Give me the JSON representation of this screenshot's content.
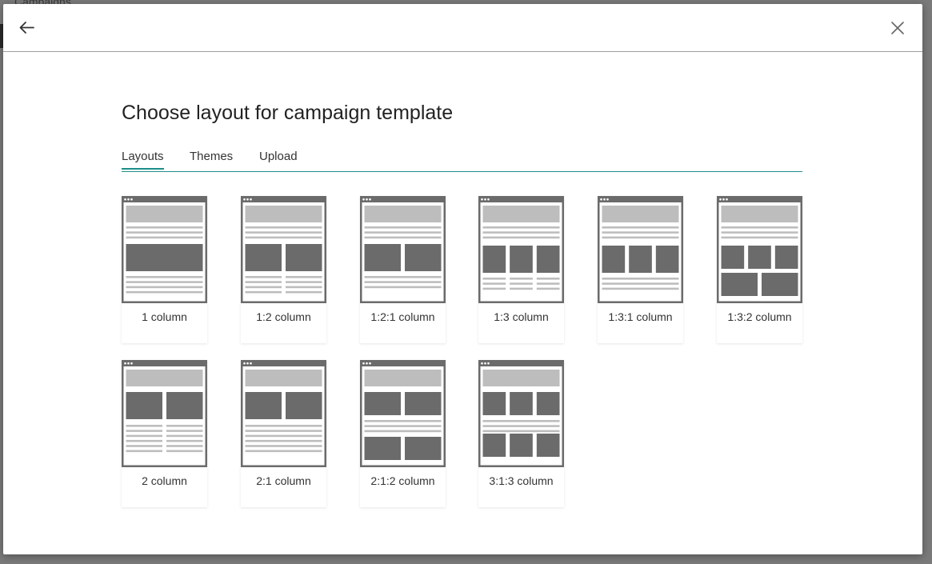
{
  "background": {
    "breadcrumb_text": "Campaigns"
  },
  "header": {
    "back_icon": "arrow-left-icon",
    "close_icon": "close-icon"
  },
  "title": "Choose layout for campaign template",
  "tabs": [
    {
      "label": "Layouts",
      "active": true
    },
    {
      "label": "Themes",
      "active": false
    },
    {
      "label": "Upload",
      "active": false
    }
  ],
  "layouts": [
    {
      "label": "1 column",
      "kind": "one"
    },
    {
      "label": "1:2 column",
      "kind": "one-two"
    },
    {
      "label": "1:2:1 column",
      "kind": "one-two-one"
    },
    {
      "label": "1:3 column",
      "kind": "one-three"
    },
    {
      "label": "1:3:1 column",
      "kind": "one-three-one"
    },
    {
      "label": "1:3:2 column",
      "kind": "one-three-two"
    },
    {
      "label": "2 column",
      "kind": "two"
    },
    {
      "label": "2:1 column",
      "kind": "two-one"
    },
    {
      "label": "2:1:2 column",
      "kind": "two-one-two"
    },
    {
      "label": "3:1:3 column",
      "kind": "three-one-three"
    }
  ],
  "colors": {
    "accent": "#1f8e8a",
    "frame": "#6b6b6b",
    "block": "#6b6b6b",
    "header_block": "#bdbdbd",
    "line": "#bdbdbd"
  }
}
